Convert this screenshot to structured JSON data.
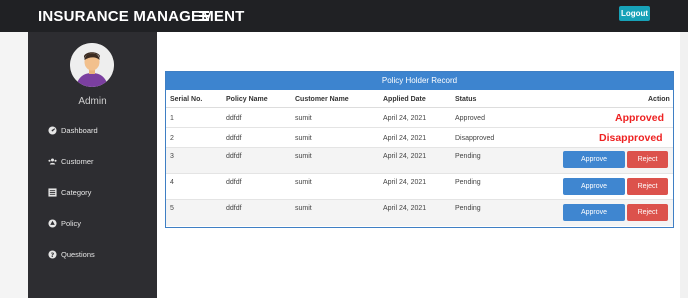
{
  "app": {
    "title": "INSURANCE MANAGEMENT",
    "logout_label": "Logout"
  },
  "sidebar": {
    "user_name": "Admin",
    "items": [
      {
        "label": "Dashboard",
        "icon": "dashboard-icon"
      },
      {
        "label": "Customer",
        "icon": "users-icon"
      },
      {
        "label": "Category",
        "icon": "list-icon"
      },
      {
        "label": "Policy",
        "icon": "policy-icon"
      },
      {
        "label": "Questions",
        "icon": "question-icon"
      }
    ]
  },
  "table": {
    "title": "Policy Holder Record",
    "headers": [
      "Serial No.",
      "Policy Name",
      "Customer Name",
      "Applied Date",
      "Status",
      "Action"
    ],
    "approve_label": "Approve",
    "reject_label": "Reject",
    "rows": [
      {
        "serial": "1",
        "policy": "ddfdf",
        "customer": "sumit",
        "date": "April 24, 2021",
        "status": "Approved",
        "action_text": "Approved"
      },
      {
        "serial": "2",
        "policy": "ddfdf",
        "customer": "sumit",
        "date": "April 24, 2021",
        "status": "Disapproved",
        "action_text": "Disapproved"
      },
      {
        "serial": "3",
        "policy": "ddfdf",
        "customer": "sumit",
        "date": "April 24, 2021",
        "status": "Pending"
      },
      {
        "serial": "4",
        "policy": "ddfdf",
        "customer": "sumit",
        "date": "April 24, 2021",
        "status": "Pending"
      },
      {
        "serial": "5",
        "policy": "ddfdf",
        "customer": "sumit",
        "date": "April 24, 2021",
        "status": "Pending"
      }
    ]
  },
  "colors": {
    "topbar": "#202124",
    "sidebar": "#2d2d31",
    "panel_header": "#3d84cf",
    "approve_button": "#3f86d0",
    "reject_button": "#dc524c",
    "status_text": "#ee2222",
    "logout_button": "#17a2b8"
  }
}
